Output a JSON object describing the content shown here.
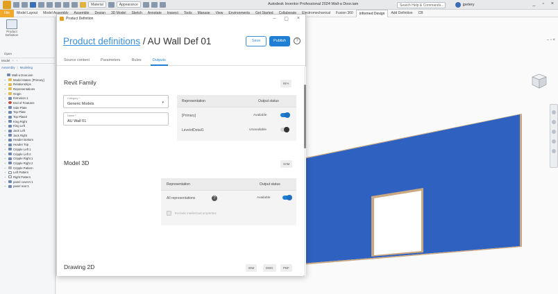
{
  "titlebar": {
    "style_dropdown": "Material",
    "appearance_dropdown": "Appearance",
    "app_title": "Autodesk Inventor Professional 2024  Wall-a Door.iam",
    "search_placeholder": "Search Help & Commands...",
    "user": "jpetery",
    "window_controls": [
      "_",
      "▫",
      "×"
    ]
  },
  "ribbon": {
    "tabs": [
      {
        "label": "File",
        "type": "file"
      },
      {
        "label": "Model Layout",
        "type": ""
      },
      {
        "label": "Model Assembly",
        "type": ""
      },
      {
        "label": "Assemble",
        "type": ""
      },
      {
        "label": "Design",
        "type": ""
      },
      {
        "label": "3D Model",
        "type": ""
      },
      {
        "label": "Sketch",
        "type": ""
      },
      {
        "label": "Annotate",
        "type": ""
      },
      {
        "label": "Inspect",
        "type": ""
      },
      {
        "label": "Tools",
        "type": ""
      },
      {
        "label": "Manage",
        "type": ""
      },
      {
        "label": "View",
        "type": ""
      },
      {
        "label": "Environments",
        "type": ""
      },
      {
        "label": "Get Started",
        "type": ""
      },
      {
        "label": "Collaborate",
        "type": ""
      },
      {
        "label": "Electromechanical",
        "type": ""
      },
      {
        "label": "Fusion 360",
        "type": ""
      },
      {
        "label": "Informed Design",
        "type": "active"
      },
      {
        "label": "Add Definition",
        "type": ""
      },
      {
        "label": "CB",
        "type": ""
      }
    ]
  },
  "leftpanel": {
    "product_button": "Product Definition",
    "open_label": "Open",
    "model_bar": {
      "label": "Model",
      "close": "×",
      "extra": "+"
    },
    "model_tabs": [
      "Assembly",
      "Modeling"
    ],
    "tree": [
      {
        "label": "Wall-a Door.iam",
        "icon": "",
        "indent": 0
      },
      {
        "label": "Model States: [Primary]",
        "icon": "folder",
        "indent": 1
      },
      {
        "label": "Relationships",
        "icon": "folder",
        "indent": 1
      },
      {
        "label": "Representations",
        "icon": "folder",
        "indent": 1
      },
      {
        "label": "Origin",
        "icon": "folder",
        "indent": 1
      },
      {
        "label": "Extrusion 1",
        "icon": "",
        "indent": 1
      },
      {
        "label": "End of Features",
        "icon": "red",
        "indent": 1
      },
      {
        "label": "Side Plate",
        "icon": "",
        "indent": 1
      },
      {
        "label": "Top Plate",
        "icon": "",
        "indent": 1
      },
      {
        "label": "Top Plate2",
        "icon": "",
        "indent": 1
      },
      {
        "label": "King Right",
        "icon": "",
        "indent": 1
      },
      {
        "label": "King Left",
        "icon": "",
        "indent": 1
      },
      {
        "label": "Jack Left",
        "icon": "",
        "indent": 1
      },
      {
        "label": "Jack Right",
        "icon": "",
        "indent": 1
      },
      {
        "label": "Header Bottom",
        "icon": "",
        "indent": 1
      },
      {
        "label": "Header Top",
        "icon": "",
        "indent": 1
      },
      {
        "label": "Cripple Left 1",
        "icon": "",
        "indent": 1
      },
      {
        "label": "Cripple Left 2",
        "icon": "",
        "indent": 1
      },
      {
        "label": "Cripple Right 1",
        "icon": "",
        "indent": 1
      },
      {
        "label": "Cripple Right 2",
        "icon": "",
        "indent": 1
      },
      {
        "label": "Cripple Pattern",
        "icon": "grey",
        "indent": 1
      },
      {
        "label": "Left Pattern",
        "icon": "pat",
        "indent": 1
      },
      {
        "label": "Right Pattern",
        "icon": "pat",
        "indent": 1
      },
      {
        "label": "panel coverA:1",
        "icon": "",
        "indent": 1
      },
      {
        "label": "panel rear:1",
        "icon": "",
        "indent": 1
      }
    ]
  },
  "dialog": {
    "window_title": "Product Definition",
    "window_controls": [
      "–",
      "▢",
      "×"
    ],
    "head_link": "Product definitions",
    "head_rest": " / AU Wall Def 01",
    "save_label": "Save",
    "publish_label": "Publish",
    "help_glyph": "?",
    "tabs": [
      {
        "label": "Source content",
        "active": false
      },
      {
        "label": "Parameters",
        "active": false
      },
      {
        "label": "Rules",
        "active": false
      },
      {
        "label": "Outputs",
        "active": true
      }
    ],
    "revit": {
      "title": "Revit Family",
      "chip": "RFA",
      "category_label": "Category *",
      "category_value": "Generic Models",
      "category_caret": "▾",
      "name_label": "Name *",
      "name_value": "AU Wall 01",
      "col_representation": "Representation",
      "col_status": "Output status",
      "rows": [
        {
          "label": "[Primary]",
          "status": "Available",
          "on": true
        },
        {
          "label": "LevelofDetail1",
          "status": "Unavailable",
          "on": false
        }
      ]
    },
    "model3d": {
      "title": "Model 3D",
      "chip": "SAM",
      "col_representation": "Representation",
      "col_status": "Output status",
      "row_label": "All representations",
      "row_status": "Available",
      "info_glyph": "?",
      "checkbox_label": "Exclude intellectual properties"
    },
    "drawing2d": {
      "title": "Drawing 2D",
      "chips": [
        "IDW",
        "DWG",
        "PDF"
      ]
    }
  },
  "colors": {
    "accent": "#1e7fd4",
    "wall_blue": "#2f61c0",
    "wall_frame": "#c9a882",
    "file_tab": "#f0a92b"
  }
}
